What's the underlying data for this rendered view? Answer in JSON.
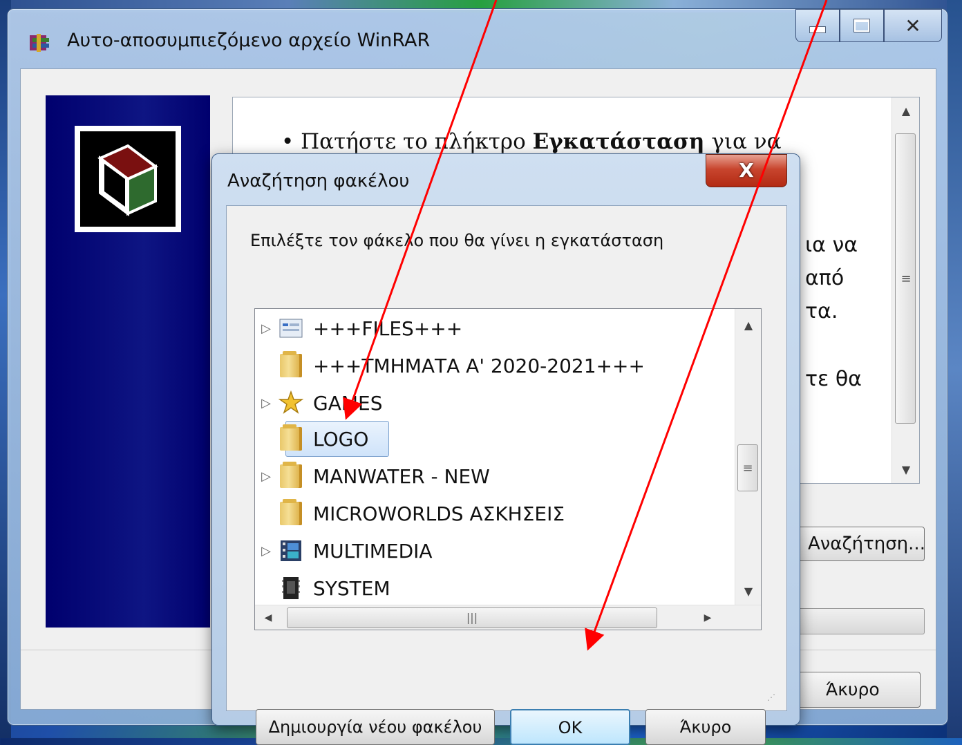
{
  "main_window": {
    "title": "Αυτο-αποσυμπιεζόμενο αρχείο WinRAR",
    "info_line1_prefix": "Πατήστε το πλήκτρο ",
    "info_line1_bold": "Εγκατάσταση",
    "info_line1_suffix": " για να",
    "frag_1": "ια να",
    "frag_2": "από",
    "frag_3": "τα.",
    "frag_4": "τε θα",
    "browse_button": "Αναζήτηση...",
    "cancel_button": "Άκυρο"
  },
  "dialog": {
    "title": "Αναζήτηση φακέλου",
    "close_glyph": "X",
    "prompt": "Επιλέξτε τον φάκελο που θα γίνει η εγκατάσταση",
    "tree_items": [
      {
        "label": "+++FILES+++",
        "icon": "files-icon",
        "expandable": true
      },
      {
        "label": "+++ΤΜΗΜΑΤΑ Α' 2020-2021+++",
        "icon": "folder-icon",
        "expandable": false
      },
      {
        "label": "GAMES",
        "icon": "star-folder-icon",
        "expandable": true
      },
      {
        "label": "LOGO",
        "icon": "folder-icon",
        "expandable": false,
        "selected": true
      },
      {
        "label": "MANWATER - NEW",
        "icon": "folder-icon",
        "expandable": true
      },
      {
        "label": "MICROWORLDS ΑΣΚΗΣΕΙΣ",
        "icon": "folder-icon",
        "expandable": false
      },
      {
        "label": "MULTIMEDIA",
        "icon": "multimedia-icon",
        "expandable": true
      },
      {
        "label": "SYSTEM",
        "icon": "system-icon",
        "expandable": false
      }
    ],
    "new_folder_button": "Δημιουργία νέου φακέλου",
    "ok_button": "OK",
    "cancel_button": "Άκυρο"
  },
  "colors": {
    "annotation_arrow": "#ff0000",
    "side_panel": "#00006e",
    "selection": "#cfe3fa"
  }
}
